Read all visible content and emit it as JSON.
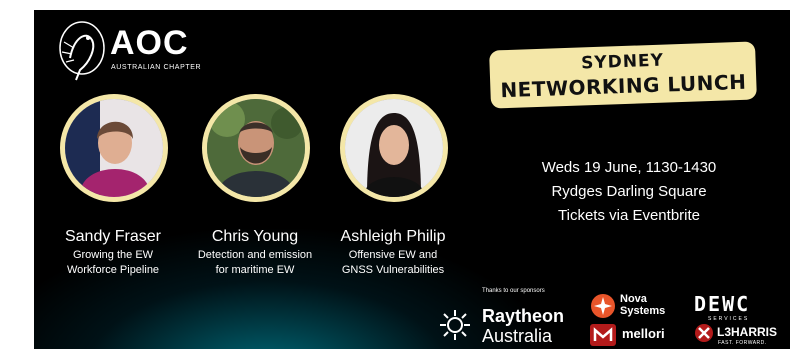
{
  "logo": {
    "name": "AOC",
    "subtitle": "AUSTRALIAN CHAPTER"
  },
  "event": {
    "title_line1": "SYDNEY",
    "title_line2": "NETWORKING LUNCH",
    "details": [
      "Weds 19 June, 1130-1430",
      "Rydges Darling Square",
      "Tickets via Eventbrite"
    ]
  },
  "speakers": [
    {
      "name": "Sandy Fraser",
      "topic": "Growing the EW\nWorkforce Pipeline"
    },
    {
      "name": "Chris Young",
      "topic": "Detection and emission\nfor maritime EW"
    },
    {
      "name": "Ashleigh Philip",
      "topic": "Offensive EW and\nGNSS Vulnerabilities"
    }
  ],
  "sponsors": {
    "label": "Thanks to our sponsors",
    "raytheon_line1": "Raytheon",
    "raytheon_line2": "Australia",
    "nova_line1": "Nova",
    "nova_line2": "Systems",
    "mellori": "mellori",
    "dewc": "DEWC",
    "dewc_sub": "SERVICES",
    "l3harris": "L3HARRIS",
    "l3harris_sub": "FAST. FORWARD."
  },
  "colors": {
    "accent": "#f4e7a8",
    "background": "#000000",
    "glow": "#0a8c9c",
    "nova_orange": "#e8552a",
    "mellori_red": "#b31b1b"
  }
}
